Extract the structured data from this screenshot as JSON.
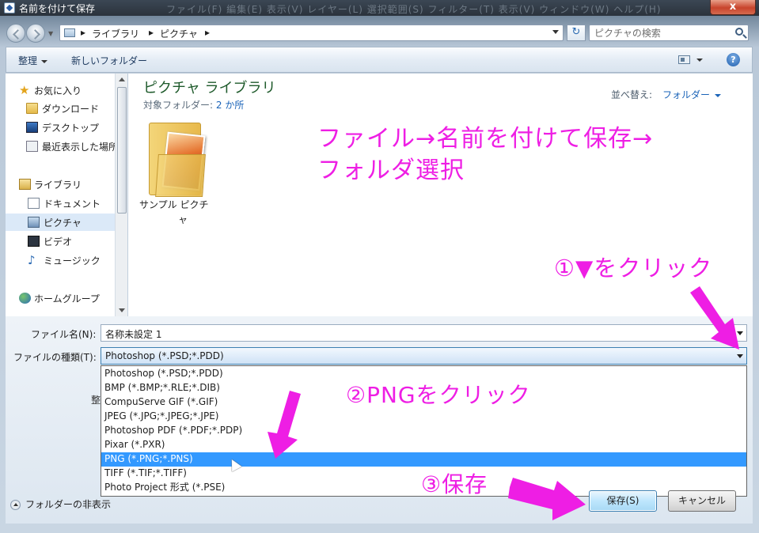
{
  "window": {
    "title": "名前を付けて保存",
    "background_menu": "ファイル(F)  編集(E)  表示(V)  レイヤー(L)  選択範囲(S)  フィルター(T)  表示(V)  ウィンドウ(W)  ヘルプ(H)",
    "close_label": "x"
  },
  "address": {
    "breadcrumb": [
      "ライブラリ",
      "ピクチャ"
    ],
    "search_placeholder": "ピクチャの検索"
  },
  "toolbar": {
    "organize": "整理",
    "new_folder": "新しいフォルダー",
    "help": "?"
  },
  "sidebar": {
    "items": [
      {
        "label": "お気に入り",
        "icon": "star-icon",
        "group": true
      },
      {
        "label": "ダウンロード",
        "icon": "download-folder-icon"
      },
      {
        "label": "デスクトップ",
        "icon": "desktop-icon"
      },
      {
        "label": "最近表示した場所",
        "icon": "recent-places-icon"
      },
      {
        "label": "ライブラリ",
        "icon": "library-icon",
        "group": true
      },
      {
        "label": "ドキュメント",
        "icon": "documents-icon"
      },
      {
        "label": "ピクチャ",
        "icon": "pictures-icon",
        "selected": true
      },
      {
        "label": "ビデオ",
        "icon": "videos-icon"
      },
      {
        "label": "ミュージック",
        "icon": "music-icon"
      },
      {
        "label": "ホームグループ",
        "icon": "homegroup-icon",
        "group": true
      }
    ]
  },
  "content": {
    "library_title": "ピクチャ ライブラリ",
    "target_label": "対象フォルダー:",
    "target_link": "2 か所",
    "sort_label": "並べ替え:",
    "sort_value": "フォルダー",
    "folder_name_line1": "サンプル ピクチ",
    "folder_name_line2": "ャ"
  },
  "form": {
    "filename_label": "ファイル名(N):",
    "filename_value": "名称未設定 1",
    "filetype_label": "ファイルの種類(T):",
    "filetype_value": "Photoshop (*.PSD;*.PDD)",
    "hidden_label": "整",
    "hide_folders": "フォルダーの非表示",
    "save_button": "保存(S)",
    "cancel_button": "キャンセル"
  },
  "filetype_options": [
    "Photoshop (*.PSD;*.PDD)",
    "BMP (*.BMP;*.RLE;*.DIB)",
    "CompuServe GIF (*.GIF)",
    "JPEG (*.JPG;*.JPEG;*.JPE)",
    "Photoshop PDF (*.PDF;*.PDP)",
    "Pixar (*.PXR)",
    "PNG (*.PNG;*.PNS)",
    "TIFF (*.TIF;*.TIFF)",
    "Photo Project 形式 (*.PSE)"
  ],
  "highlighted_option": "PNG (*.PNG;*.PNS)",
  "annotations": {
    "instruction_line1": "ファイル→名前を付けて保存→",
    "instruction_line2": "フォルダ選択",
    "step1": "①▼をクリック",
    "step2": "②PNGをクリック",
    "step3": "③保存"
  },
  "colors": {
    "annotation": "#ee1ee4",
    "selection": "#3399ff"
  }
}
